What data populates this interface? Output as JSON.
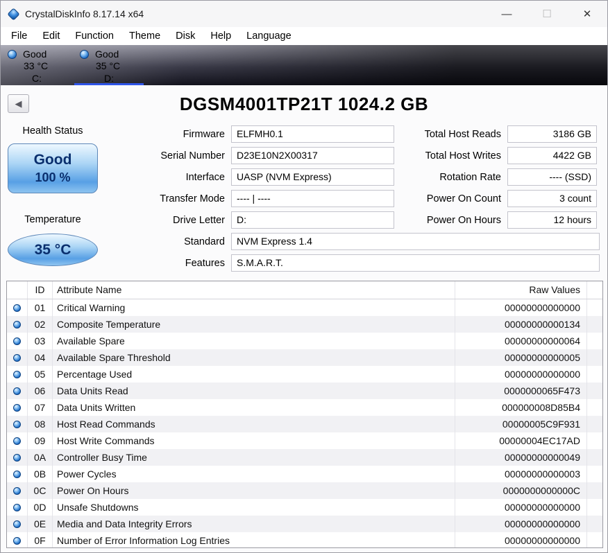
{
  "window": {
    "title": "CrystalDiskInfo 8.17.14 x64",
    "controls": {
      "minimize": "—",
      "maximize": "☐",
      "close": "✕"
    }
  },
  "icons": {
    "back": "◀"
  },
  "colors": {
    "accent_underline": "#2f55e8",
    "orb_blue": "#1565c0",
    "health_button_text": "#0a2f6e",
    "drivebar_dark": "#10101a"
  },
  "menu": {
    "items": [
      "File",
      "Edit",
      "Function",
      "Theme",
      "Disk",
      "Help",
      "Language"
    ]
  },
  "drives": [
    {
      "status": "Good",
      "temp": "33 °C",
      "letter": "C:",
      "selected": false
    },
    {
      "status": "Good",
      "temp": "35 °C",
      "letter": "D:",
      "selected": true
    }
  ],
  "main": {
    "model_title": "DGSM4001TP21T 1024.2 GB",
    "health": {
      "label": "Health Status",
      "status": "Good",
      "percent": "100 %"
    },
    "temperature": {
      "label": "Temperature",
      "value": "35 °C"
    },
    "info_mid": [
      {
        "label": "Firmware",
        "value": "ELFMH0.1"
      },
      {
        "label": "Serial Number",
        "value": "D23E10N2X00317"
      },
      {
        "label": "Interface",
        "value": "UASP (NVM Express)"
      },
      {
        "label": "Transfer Mode",
        "value": "---- | ----"
      },
      {
        "label": "Drive Letter",
        "value": "D:"
      }
    ],
    "info_wide": [
      {
        "label": "Standard",
        "value": "NVM Express 1.4"
      },
      {
        "label": "Features",
        "value": "S.M.A.R.T."
      }
    ],
    "info_right": [
      {
        "label": "Total Host Reads",
        "value": "3186 GB"
      },
      {
        "label": "Total Host Writes",
        "value": "4422 GB"
      },
      {
        "label": "Rotation Rate",
        "value": "---- (SSD)"
      },
      {
        "label": "Power On Count",
        "value": "3 count"
      },
      {
        "label": "Power On Hours",
        "value": "12 hours"
      }
    ]
  },
  "smart_table": {
    "headers": {
      "id": "ID",
      "name": "Attribute Name",
      "raw": "Raw Values"
    },
    "rows": [
      {
        "id": "01",
        "name": "Critical Warning",
        "raw": "00000000000000"
      },
      {
        "id": "02",
        "name": "Composite Temperature",
        "raw": "00000000000134"
      },
      {
        "id": "03",
        "name": "Available Spare",
        "raw": "00000000000064"
      },
      {
        "id": "04",
        "name": "Available Spare Threshold",
        "raw": "00000000000005"
      },
      {
        "id": "05",
        "name": "Percentage Used",
        "raw": "00000000000000"
      },
      {
        "id": "06",
        "name": "Data Units Read",
        "raw": "0000000065F473"
      },
      {
        "id": "07",
        "name": "Data Units Written",
        "raw": "000000008D85B4"
      },
      {
        "id": "08",
        "name": "Host Read Commands",
        "raw": "00000005C9F931"
      },
      {
        "id": "09",
        "name": "Host Write Commands",
        "raw": "00000004EC17AD"
      },
      {
        "id": "0A",
        "name": "Controller Busy Time",
        "raw": "00000000000049"
      },
      {
        "id": "0B",
        "name": "Power Cycles",
        "raw": "00000000000003"
      },
      {
        "id": "0C",
        "name": "Power On Hours",
        "raw": "0000000000000C"
      },
      {
        "id": "0D",
        "name": "Unsafe Shutdowns",
        "raw": "00000000000000"
      },
      {
        "id": "0E",
        "name": "Media and Data Integrity Errors",
        "raw": "00000000000000"
      },
      {
        "id": "0F",
        "name": "Number of Error Information Log Entries",
        "raw": "00000000000000"
      }
    ]
  }
}
